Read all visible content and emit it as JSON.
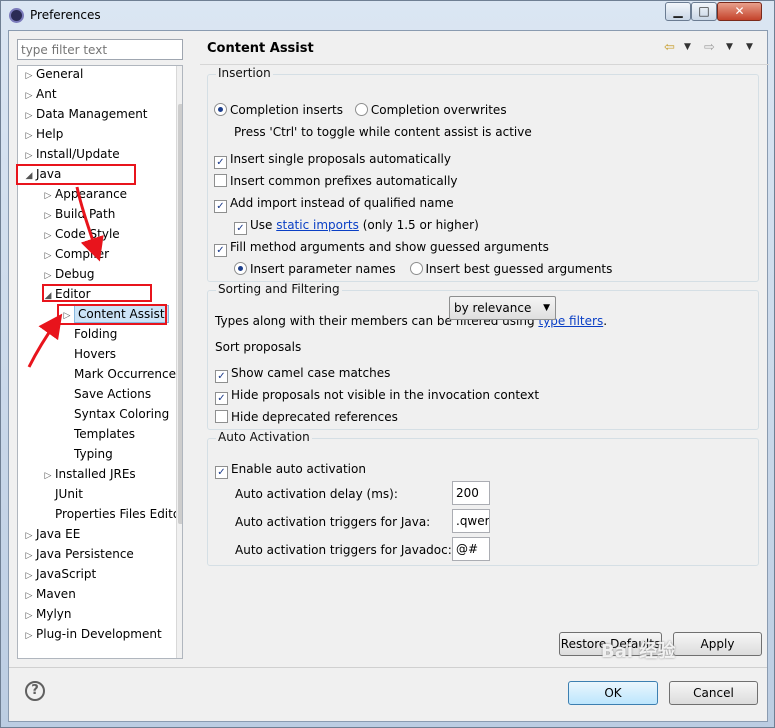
{
  "window": {
    "title": "Preferences"
  },
  "filter": {
    "placeholder": "type filter text"
  },
  "tree": {
    "items": [
      {
        "label": "General",
        "state": "collapsed"
      },
      {
        "label": "Ant",
        "state": "collapsed"
      },
      {
        "label": "Data Management",
        "state": "collapsed"
      },
      {
        "label": "Help",
        "state": "collapsed"
      },
      {
        "label": "Install/Update",
        "state": "collapsed"
      },
      {
        "label": "Java",
        "state": "expanded"
      },
      {
        "label": "Appearance",
        "state": "collapsed"
      },
      {
        "label": "Build Path",
        "state": "collapsed"
      },
      {
        "label": "Code Style",
        "state": "collapsed"
      },
      {
        "label": "Compiler",
        "state": "collapsed"
      },
      {
        "label": "Debug",
        "state": "collapsed"
      },
      {
        "label": "Editor",
        "state": "expanded"
      },
      {
        "label": "Content Assist",
        "state": "collapsed"
      },
      {
        "label": "Folding",
        "state": "leaf"
      },
      {
        "label": "Hovers",
        "state": "leaf"
      },
      {
        "label": "Mark Occurrences",
        "state": "leaf"
      },
      {
        "label": "Save Actions",
        "state": "leaf"
      },
      {
        "label": "Syntax Coloring",
        "state": "leaf"
      },
      {
        "label": "Templates",
        "state": "leaf"
      },
      {
        "label": "Typing",
        "state": "leaf"
      },
      {
        "label": "Installed JREs",
        "state": "collapsed"
      },
      {
        "label": "JUnit",
        "state": "leaf"
      },
      {
        "label": "Properties Files Editor",
        "state": "leaf"
      },
      {
        "label": "Java EE",
        "state": "collapsed"
      },
      {
        "label": "Java Persistence",
        "state": "collapsed"
      },
      {
        "label": "JavaScript",
        "state": "collapsed"
      },
      {
        "label": "Maven",
        "state": "collapsed"
      },
      {
        "label": "Mylyn",
        "state": "collapsed"
      },
      {
        "label": "Plug-in Development",
        "state": "collapsed"
      }
    ]
  },
  "page": {
    "title": "Content Assist"
  },
  "insertion": {
    "title": "Insertion",
    "completion_inserts": "Completion inserts",
    "completion_overwrites": "Completion overwrites",
    "toggle_hint": "Press 'Ctrl' to toggle while content assist is active",
    "insert_single": "Insert single proposals automatically",
    "insert_common": "Insert common prefixes automatically",
    "add_import": "Add import instead of qualified name",
    "use_prefix": "Use",
    "static_imports": "static imports",
    "use_suffix": "(only 1.5 or higher)",
    "fill_method": "Fill method arguments and show guessed arguments",
    "insert_param_names": "Insert parameter names",
    "insert_best_guessed": "Insert best guessed arguments"
  },
  "sorting": {
    "title": "Sorting and Filtering",
    "types_prefix": "Types along with their members can be filtered using",
    "type_filters": "type filters",
    "types_suffix": ".",
    "sort_proposals": "Sort proposals",
    "sort_value": "by relevance",
    "show_camel": "Show camel case matches",
    "hide_not_visible": "Hide proposals not visible in the invocation context",
    "hide_deprecated": "Hide deprecated references"
  },
  "auto": {
    "title": "Auto Activation",
    "enable": "Enable auto activation",
    "delay_label": "Auto activation delay (ms):",
    "delay_value": "200",
    "java_label": "Auto activation triggers for Java:",
    "java_value": ".qwer",
    "javadoc_label": "Auto activation triggers for Javadoc:",
    "javadoc_value": "@#"
  },
  "buttons": {
    "restore": "Restore Defaults",
    "apply": "Apply",
    "ok": "OK",
    "cancel": "Cancel",
    "help": "?"
  },
  "checks": {
    "insert_single": true,
    "insert_common": false,
    "add_import": true,
    "use_static": true,
    "fill_method": true,
    "show_camel": true,
    "hide_not_visible": true,
    "hide_deprecated": false,
    "enable_auto": true
  },
  "colors": {
    "annotation_red": "#e8141c",
    "link": "#0a3fc5"
  },
  "watermark": "Bai 经验"
}
